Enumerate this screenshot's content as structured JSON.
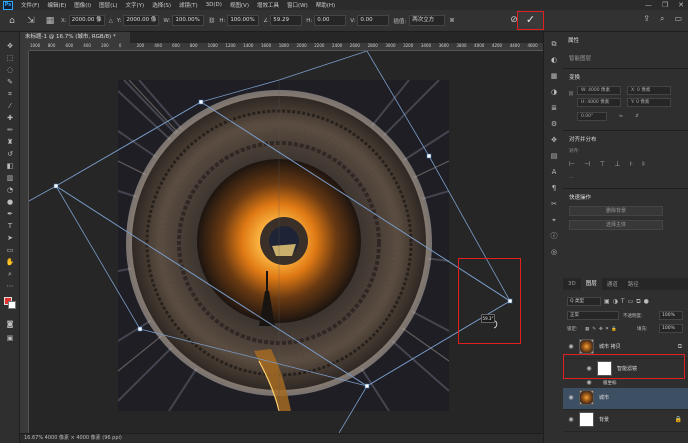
{
  "app": {
    "logo": "Ps",
    "menu": [
      "文件(F)",
      "编辑(E)",
      "图像(I)",
      "图层(L)",
      "文字(Y)",
      "选择(S)",
      "滤镜(T)",
      "3D(D)",
      "视图(V)",
      "增效工具",
      "窗口(W)",
      "帮助(H)"
    ],
    "window_controls": [
      "—",
      "❐",
      "✕"
    ]
  },
  "options_bar": {
    "x_label": "X:",
    "x_value": "2000.00 像",
    "y_label": "Y:",
    "y_value": "2000.00 像",
    "w_label": "W:",
    "w_value": "100.00%",
    "h_label": "H:",
    "h_value": "100.00%",
    "angle_value": "59.29",
    "hskew_label": "H:",
    "hskew_value": "0.00",
    "vskew_label": "V:",
    "vskew_value": "0.00",
    "interp_label": "插值:",
    "interp_value": "两次立方",
    "commit_symbol": "✓",
    "cancel_symbol": "⊘"
  },
  "document": {
    "tab": "未标题-1 @ 16.7% (城市, RGB/8) *",
    "ruler_ticks": [
      "1000",
      "800",
      "600",
      "400",
      "200",
      "0",
      "200",
      "400",
      "600",
      "800",
      "1000",
      "1200",
      "1400",
      "1600",
      "1800",
      "2000",
      "2200",
      "2400",
      "2600",
      "2800",
      "3000",
      "3200",
      "3400",
      "3600",
      "3800",
      "4000",
      "4200",
      "4400",
      "4600",
      "4800"
    ],
    "angle_tip": "59.3°",
    "status": "16.67%     4000 像素 × 4000 像素 (96 ppi)"
  },
  "properties_panel": {
    "tab": "属性",
    "subtitle": "智能图层",
    "transform_title": "变换",
    "w_field": "W: 4000 像素",
    "h_field": "H: 4000 像素",
    "x_field": "X: 0 像素",
    "y_field": "Y: 0 像素",
    "angle_field": "0.00°",
    "align_title": "对齐并分布",
    "align_label": "对齐:",
    "quick_title": "快速操作",
    "quick_btn_1": "删除背景",
    "quick_btn_2": "选择主体"
  },
  "layers_panel": {
    "tabs": [
      "3D",
      "图层",
      "通道",
      "路径"
    ],
    "filter_value": "Q 类型",
    "blend_mode": "正常",
    "opacity_label": "不透明度:",
    "opacity_value": "100%",
    "lock_label": "锁定:",
    "fill_label": "填充:",
    "fill_value": "100%",
    "layers": [
      {
        "name": "城市 拷贝"
      },
      {
        "name": "智能滤镜"
      },
      {
        "name": "极坐标"
      },
      {
        "name": "城市"
      },
      {
        "name": "背景"
      }
    ]
  },
  "colors": {
    "accent_red": "#e02020",
    "selected_row": "#3d4f63",
    "foreground": "#e03030",
    "background": "#ffffff"
  }
}
